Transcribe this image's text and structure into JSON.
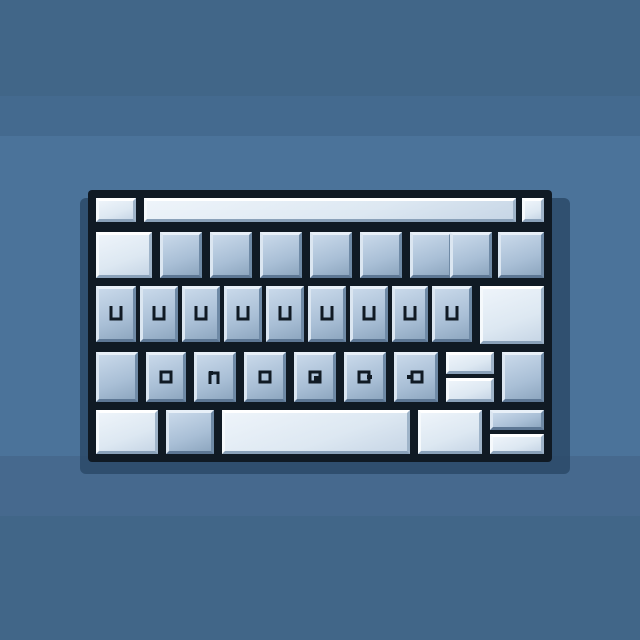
{
  "image": {
    "subject": "keyboard-icon",
    "style": "pixel-art"
  },
  "colors": {
    "background": "#4a6f95",
    "key_face": "#b4c8dc",
    "key_light": "#e4edf5",
    "frame": "#101a24"
  },
  "keyboard": {
    "rows": [
      {
        "row": "top-strip",
        "keys": [
          "key",
          "space-bar",
          "key"
        ]
      },
      {
        "row": "number-row",
        "keys": [
          "key",
          "key",
          "key",
          "key",
          "key",
          "key",
          "key",
          "key",
          "key"
        ]
      },
      {
        "row": "letter-row-1",
        "keys": [
          "u-glyph-key",
          "u-glyph-key",
          "u-glyph-key",
          "u-glyph-key",
          "u-glyph-key",
          "u-glyph-key",
          "u-glyph-key",
          "u-glyph-key",
          "u-glyph-key",
          "enter-key"
        ]
      },
      {
        "row": "letter-row-2",
        "keys": [
          "key",
          "dot-glyph-key",
          "arch-glyph-key",
          "dot-glyph-key",
          "dot-glyph-key",
          "dot-glyph-key",
          "dot-glyph-key",
          "split-key",
          "key"
        ]
      },
      {
        "row": "bottom-row",
        "keys": [
          "key",
          "key",
          "space-bar",
          "key",
          "split-key"
        ]
      }
    ]
  }
}
